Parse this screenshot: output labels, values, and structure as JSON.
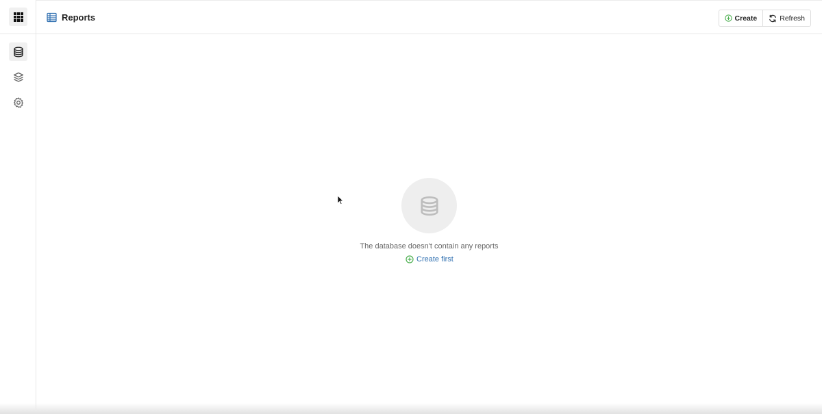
{
  "header": {
    "title": "Reports",
    "title_icon": "table-icon",
    "create_label": "Create",
    "refresh_label": "Refresh"
  },
  "sidebar": {
    "apps_icon": "grid-icon",
    "items": [
      {
        "name": "database",
        "icon": "database-icon",
        "active": true
      },
      {
        "name": "layers",
        "icon": "layers-icon",
        "active": false
      },
      {
        "name": "settings",
        "icon": "gear-icon",
        "active": false
      }
    ]
  },
  "empty_state": {
    "icon": "database-icon",
    "message": "The database doesn't contain any reports",
    "create_first_label": "Create first"
  },
  "colors": {
    "accent_blue": "#2f6fb0",
    "accent_green": "#4caf50",
    "icon_gray": "#bdbdbd"
  }
}
